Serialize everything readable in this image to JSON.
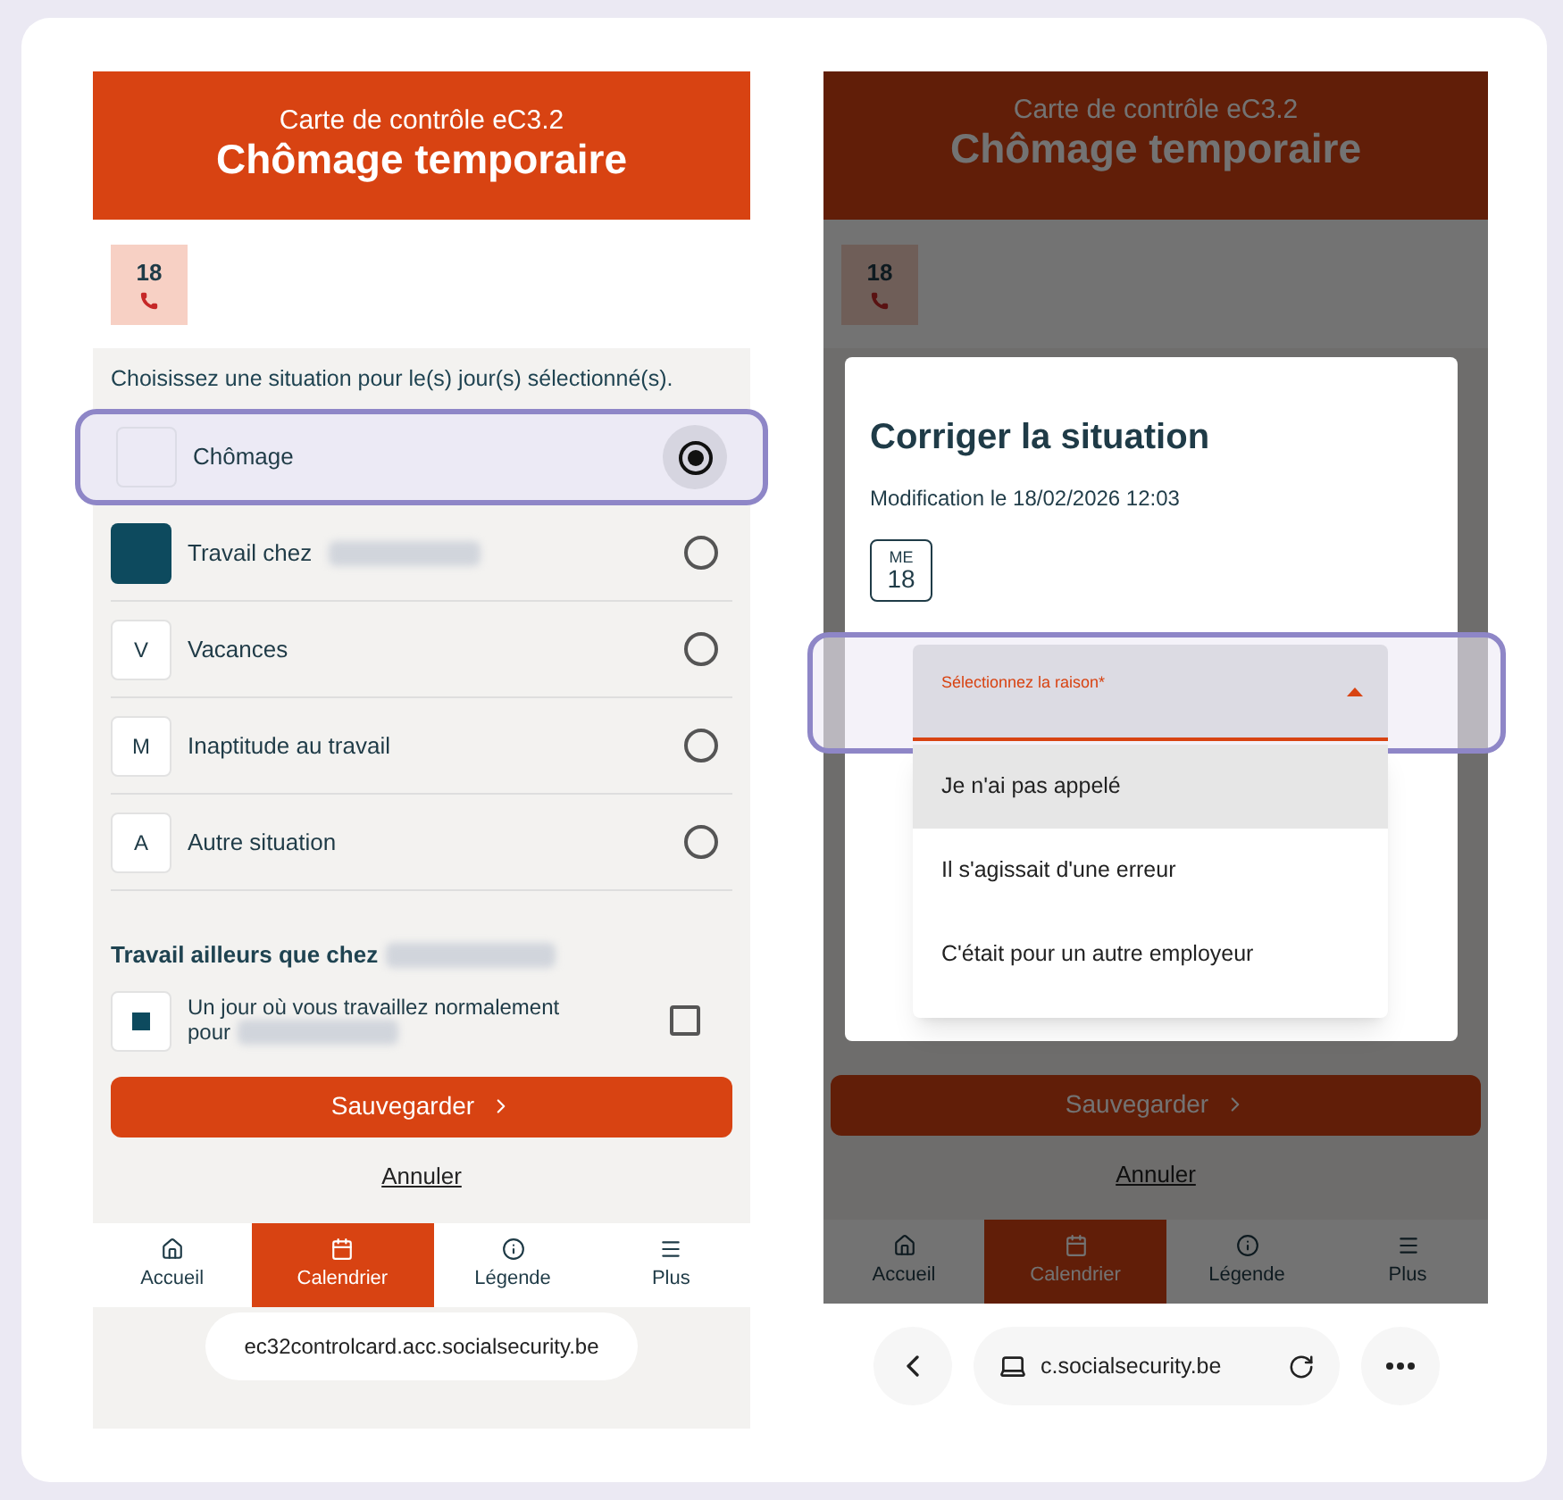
{
  "left_screen": {
    "header": {
      "subtitle": "Carte de contrôle eC3.2",
      "title": "Chômage temporaire"
    },
    "day": {
      "number": "18"
    },
    "instruction": "Choisissez une situation pour le(s) jour(s) sélectionné(s).",
    "options": [
      {
        "kind": "empty",
        "label": "Chômage",
        "redacted": false,
        "selected": true
      },
      {
        "kind": "filled",
        "label": "Travail chez",
        "redacted": true,
        "selected": false
      },
      {
        "kind": "letter",
        "code": "V",
        "label": "Vacances",
        "redacted": false,
        "selected": false
      },
      {
        "kind": "letter",
        "code": "M",
        "label": "Inaptitude au travail",
        "redacted": false,
        "selected": false
      },
      {
        "kind": "letter",
        "code": "A",
        "label": "Autre situation",
        "redacted": false,
        "selected": false
      }
    ],
    "other_work": {
      "heading": "Travail ailleurs que chez",
      "redacted": true,
      "label": "Un jour où vous travaillez normalement pour",
      "checked": false
    },
    "save_button": "Sauvegarder",
    "cancel_link": "Annuler",
    "nav": [
      {
        "label": "Accueil",
        "selected": false
      },
      {
        "label": "Calendrier",
        "selected": true
      },
      {
        "label": "Légende",
        "selected": false
      },
      {
        "label": "Plus",
        "selected": false
      }
    ],
    "url": "ec32controlcard.acc.socialsecurity.be"
  },
  "right_screen": {
    "header": {
      "subtitle": "Carte de contrôle eC3.2",
      "title": "Chômage temporaire"
    },
    "day": {
      "number": "18"
    },
    "save_button": "Sauvegarder",
    "cancel_link": "Annuler",
    "nav": [
      {
        "label": "Accueil",
        "selected": false
      },
      {
        "label": "Calendrier",
        "selected": true
      },
      {
        "label": "Légende",
        "selected": false
      },
      {
        "label": "Plus",
        "selected": false
      }
    ],
    "modal": {
      "title": "Corriger la situation",
      "subtitle": "Modification le 18/02/2026 12:03",
      "day": {
        "weekday": "ME",
        "number": "18"
      },
      "select": {
        "label": "Sélectionnez la raison*",
        "expanded": true
      },
      "options": [
        {
          "label": "Je n'ai pas appelé",
          "highlighted": true
        },
        {
          "label": "Il s'agissait d'une erreur",
          "highlighted": false
        },
        {
          "label": "C'était pour un autre employeur",
          "highlighted": false
        }
      ]
    },
    "url": "c.socialsecurity.be"
  }
}
